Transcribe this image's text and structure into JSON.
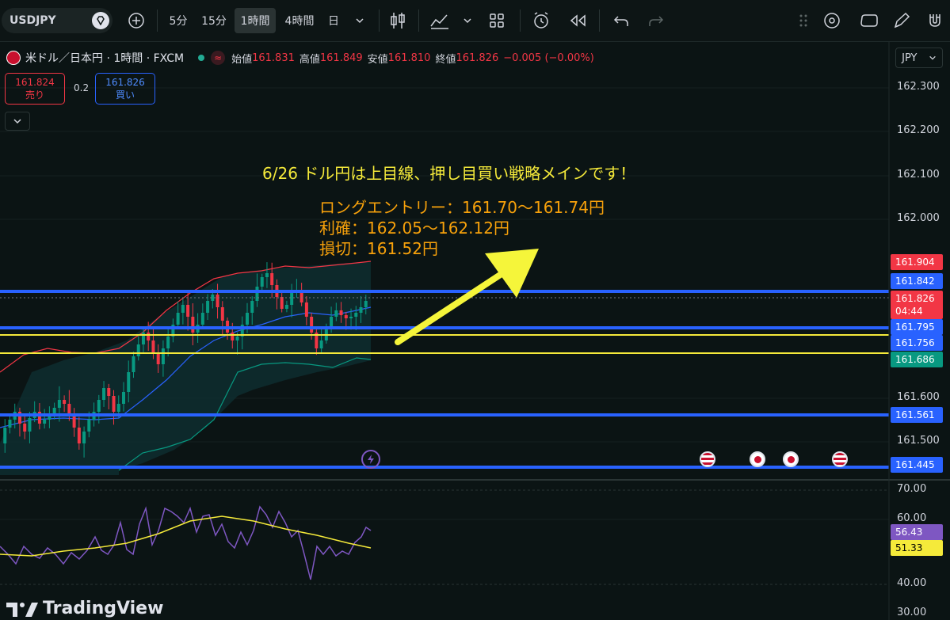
{
  "toolbar": {
    "symbol": "USDJPY",
    "timeframes": [
      "5分",
      "15分",
      "1時間",
      "4時間",
      "日"
    ],
    "active_timeframe": "1時間"
  },
  "legend": {
    "title": "米ドル／日本円 · 1時間 · FXCM",
    "open_label": "始値",
    "open": "161.831",
    "high_label": "高値",
    "high": "161.849",
    "low_label": "安値",
    "low": "161.810",
    "close_label": "終値",
    "close": "161.826",
    "change": "−0.005 (−0.00%)"
  },
  "trade": {
    "sell_price": "161.824",
    "sell_label": "売り",
    "spread": "0.2",
    "buy_price": "161.826",
    "buy_label": "買い"
  },
  "currency": "JPY",
  "price_axis": [
    "162.300",
    "162.200",
    "162.100",
    "162.000",
    "161.600",
    "161.500"
  ],
  "price_tags": [
    {
      "value": "161.904",
      "color": "#f23645"
    },
    {
      "value": "161.842",
      "color": "#2962ff"
    },
    {
      "value": "161.826",
      "sub": "04:44",
      "color": "#f23645"
    },
    {
      "value": "161.795",
      "color": "#2962ff"
    },
    {
      "value": "161.756",
      "color": "#2962ff"
    },
    {
      "value": "161.686",
      "color": "#089981"
    },
    {
      "value": "161.561",
      "color": "#2962ff"
    },
    {
      "value": "161.445",
      "color": "#2962ff"
    }
  ],
  "oscillator_axis": [
    "70.00",
    "60.00",
    "40.00",
    "30.00"
  ],
  "oscillator_tags": [
    {
      "value": "56.43",
      "color": "#7e57c2"
    },
    {
      "value": "51.33",
      "color": "#f5ea3a"
    }
  ],
  "annotation": {
    "title": "6/26 ドル円は上目線、押し目買い戦略メインです！",
    "long_entry": "ロングエントリー：161.70〜161.74円",
    "take_profit": "利確：162.05〜162.12円",
    "stop_loss": "損切：161.52円"
  },
  "brand": "TradingView",
  "icons": [
    "diamond-icon",
    "plus-circle-icon",
    "chevron-down-icon",
    "candles-icon",
    "indicators-icon",
    "layout-icon",
    "alert-icon",
    "replay-icon",
    "undo-icon",
    "redo-icon",
    "drag-icon",
    "target-icon",
    "shape-icon",
    "pen-icon",
    "magnet-icon"
  ]
}
